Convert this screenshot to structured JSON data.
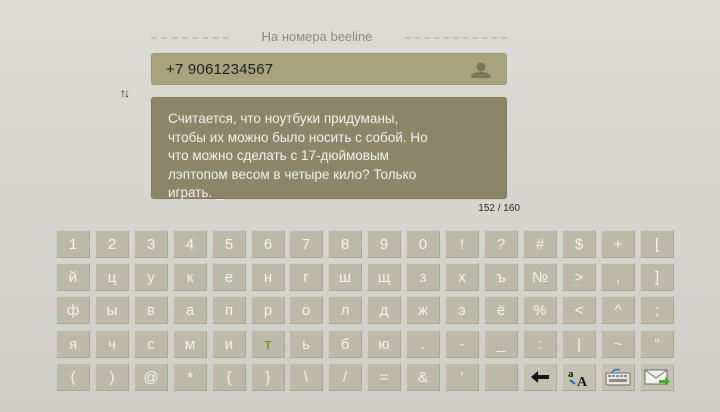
{
  "header": {
    "title": "На номера beeline"
  },
  "phone": {
    "value": "+7 9061234567"
  },
  "switch_icon": {
    "glyph": "↑↓"
  },
  "message": {
    "lines": [
      "Считается, что ноутбуки придуманы,",
      "чтобы их можно было носить с собой. Но",
      "что можно сделать с 17-дюймовым",
      "лэптопом весом в четыре кило? Только",
      "играть. _"
    ]
  },
  "counter": {
    "text": "152 / 160"
  },
  "keyboard": {
    "rows": [
      [
        "1",
        "2",
        "3",
        "4",
        "5",
        "6",
        "7",
        "8",
        "9",
        "0",
        "!",
        "?",
        "#",
        "$",
        "+",
        "["
      ],
      [
        "й",
        "ц",
        "у",
        "к",
        "е",
        "н",
        "г",
        "ш",
        "щ",
        "з",
        "х",
        "ъ",
        "№",
        ">",
        ",",
        "]"
      ],
      [
        "ф",
        "ы",
        "в",
        "а",
        "п",
        "р",
        "о",
        "л",
        "д",
        "ж",
        "э",
        "ё",
        "%",
        "<",
        "^",
        ";"
      ],
      [
        "я",
        "ч",
        "с",
        "м",
        "и",
        "т",
        "ь",
        "б",
        "ю",
        ".",
        "-",
        "_",
        ":",
        "|",
        "~",
        "\""
      ],
      [
        "(",
        ")",
        "@",
        "*",
        "{",
        "}",
        "\\",
        "/",
        "=",
        "&",
        "'",
        "",
        "←",
        "aA",
        "⌨",
        "✉"
      ]
    ],
    "active_key": "т",
    "func_icons": {
      "backspace": "arrow-left-icon",
      "case": "case-toggle-icon",
      "layout": "keyboard-layout-icon",
      "send": "send-message-icon"
    }
  },
  "colors": {
    "accent": "#6c8b1a",
    "field": "#a8a37d",
    "message_bg": "#8c8568",
    "key": "#bdb9a8"
  }
}
